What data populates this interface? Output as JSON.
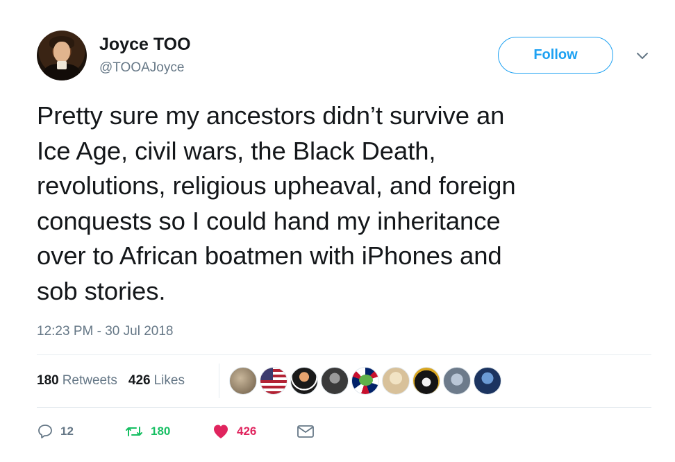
{
  "author": {
    "display_name": "Joyce TOO",
    "handle": "@TOOAJoyce",
    "avatar_icon": "portrait-avatar"
  },
  "header": {
    "follow_label": "Follow",
    "caret_icon": "chevron-down-icon"
  },
  "tweet": {
    "text": "Pretty sure my ancestors didn’t survive an\nIce Age, civil wars, the Black Death,\nrevolutions, religious upheaval, and foreign\nconquests so I could hand my inheritance\nover to African boatmen with iPhones and\nsob stories.",
    "timestamp": "12:23 PM - 30 Jul 2018"
  },
  "stats": {
    "retweets_count": "180",
    "retweets_label": "Retweets",
    "likes_count": "426",
    "likes_label": "Likes"
  },
  "actions": {
    "reply_count": "12",
    "retweet_count": "180",
    "like_count": "426"
  },
  "colors": {
    "accent": "#1da1f2",
    "retweet": "#17bf63",
    "like": "#e0245e",
    "muted": "#657786"
  }
}
